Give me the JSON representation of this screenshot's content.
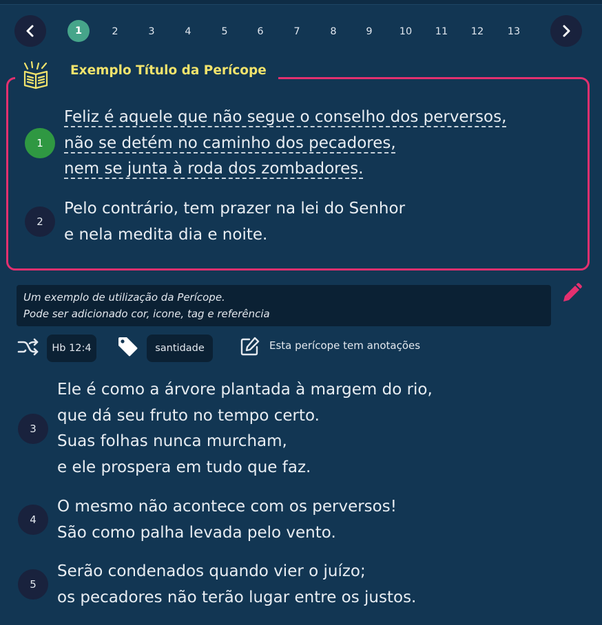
{
  "pager": {
    "pages": [
      "1",
      "2",
      "3",
      "4",
      "5",
      "6",
      "7",
      "8",
      "9",
      "10",
      "11",
      "12",
      "13"
    ],
    "active": "1"
  },
  "pericope": {
    "title": "Exemplo Título da Perícope",
    "verses": [
      {
        "num": "1",
        "lines": [
          "Feliz é aquele que não segue o conselho dos perversos,",
          "não se detém no caminho dos pecadores,",
          "nem se junta à roda dos zombadores."
        ]
      },
      {
        "num": "2",
        "lines": [
          "Pelo contrário, tem prazer na lei do Senhor",
          "e nela medita dia e noite."
        ]
      }
    ],
    "note_lines": [
      "Um exemplo de utilização da Perícope.",
      "Pode ser adicionado cor, icone, tag e referência"
    ],
    "reference": "Hb 12:4",
    "tag": "santidade",
    "annotation_text": "Esta perícope tem anotações",
    "colors": {
      "border": "#e3306f",
      "title": "#f1e36c",
      "highlight": "#2f9842"
    }
  },
  "verses": [
    {
      "num": "3",
      "lines": [
        "Ele é como a árvore plantada à margem do rio,",
        "que dá seu fruto no tempo certo.",
        "Suas folhas nunca murcham,",
        "e ele prospera em tudo que faz."
      ]
    },
    {
      "num": "4",
      "lines": [
        "O mesmo não acontece com os perversos!",
        "São como palha levada pelo vento."
      ]
    },
    {
      "num": "5",
      "lines": [
        "Serão condenados quando vier o juízo;",
        "os pecadores não terão lugar entre os justos."
      ]
    }
  ],
  "icons": {
    "prev": "chevron-left-icon",
    "next": "chevron-right-icon",
    "pericope": "scroll-icon",
    "edit": "pencil-icon",
    "crossref": "cross-reference-icon",
    "tag": "tag-icon",
    "annotation": "edit-note-icon"
  }
}
